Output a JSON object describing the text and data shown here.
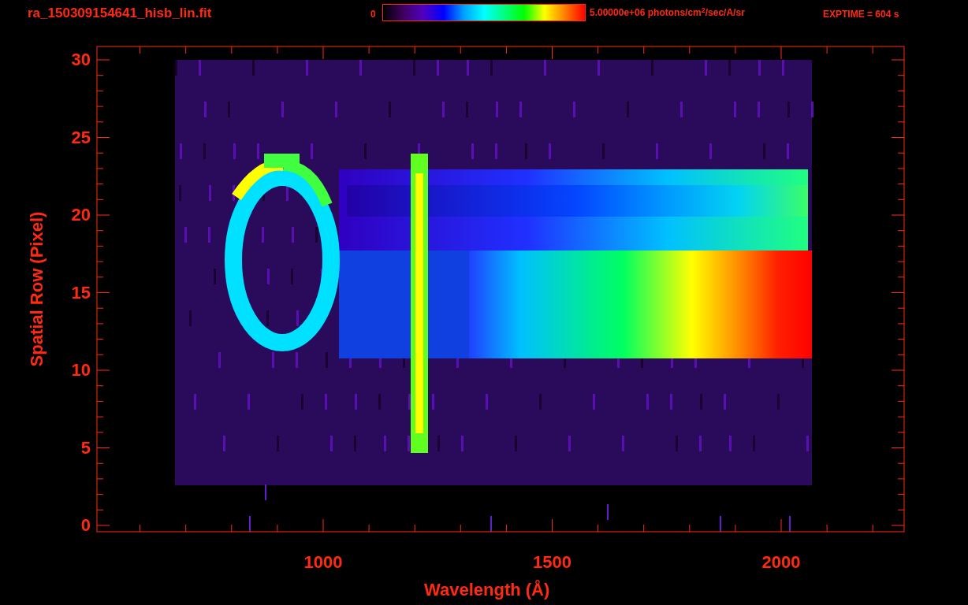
{
  "header": {
    "filename": "ra_150309154641_hisb_lin.fit",
    "colorbar_min": "0",
    "colorbar_max": "5.00000e+06 photons/cm$^{2}$/sec/A/sr",
    "exptime": "EXPTIME = 604 s"
  },
  "plot": {
    "ylabel": "Spatial Row (Pixel)",
    "xlabel": "Wavelength (Å)",
    "yticks": [
      "30",
      "25",
      "20",
      "15",
      "10",
      "5",
      "0"
    ],
    "xticks": [
      "1000",
      "1500",
      "2000"
    ]
  }
}
